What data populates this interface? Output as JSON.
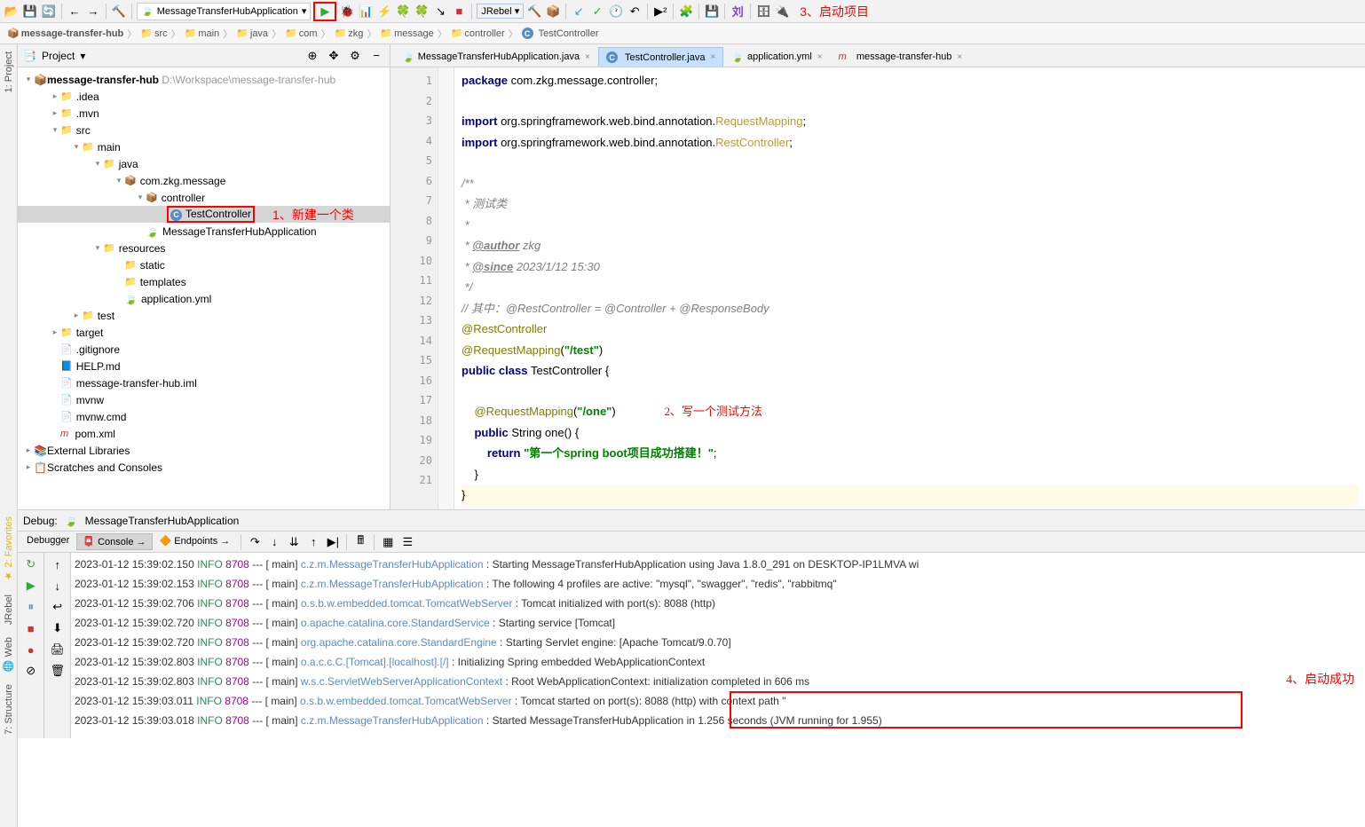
{
  "toolbar": {
    "run_config": "MessageTransferHubApplication",
    "jrebel": "JRebel"
  },
  "breadcrumb": [
    "message-transfer-hub",
    "src",
    "main",
    "java",
    "com",
    "zkg",
    "message",
    "controller",
    "TestController"
  ],
  "project": {
    "title": "Project",
    "root": "message-transfer-hub",
    "root_path": "D:\\Workspace\\message-transfer-hub",
    "tree": {
      "idea": ".idea",
      "mvn": ".mvn",
      "src": "src",
      "main": "main",
      "java": "java",
      "pkg": "com.zkg.message",
      "controller": "controller",
      "test_controller": "TestController",
      "app_class": "MessageTransferHubApplication",
      "resources": "resources",
      "static": "static",
      "templates": "templates",
      "appyml": "application.yml",
      "test": "test",
      "target": "target",
      "gitignore": ".gitignore",
      "help": "HELP.md",
      "iml": "message-transfer-hub.iml",
      "mvnw": "mvnw",
      "mvnwcmd": "mvnw.cmd",
      "pom": "pom.xml",
      "ext_lib": "External Libraries",
      "scratches": "Scratches and Consoles"
    }
  },
  "annotations": {
    "a1": "1、新建一个类",
    "a2": "2、写一个测试方法",
    "a3": "3、启动项目",
    "a4": "4、启动成功"
  },
  "tabs": [
    {
      "label": "MessageTransferHubApplication.java",
      "active": false
    },
    {
      "label": "TestController.java",
      "active": true
    },
    {
      "label": "application.yml",
      "active": false
    },
    {
      "label": "message-transfer-hub",
      "active": false
    }
  ],
  "code": {
    "l1_kw": "package",
    "l1_rest": " com.zkg.message.controller;",
    "l3_kw": "import",
    "l3_rest": " org.springframework.web.bind.annotation.",
    "l3_ref": "RequestMapping",
    "l3_end": ";",
    "l4_kw": "import",
    "l4_rest": " org.springframework.web.bind.annotation.",
    "l4_ref": "RestController",
    "l4_end": ";",
    "l6": "/**",
    "l7": " * 测试类",
    "l8": " *",
    "l9a": " * ",
    "l9b": "@author",
    "l9c": " zkg",
    "l10a": " * ",
    "l10b": "@since",
    "l10c": " 2023/1/12 15:30",
    "l11": " */",
    "l12": "// 其中：@RestController = @Controller + @ResponseBody",
    "l13": "@RestController",
    "l14a": "@RequestMapping",
    "l14b": "(",
    "l14c": "\"/test\"",
    "l14d": ")",
    "l15a": "public class ",
    "l15b": "TestController ",
    "l15c": "{",
    "l17a": "    ",
    "l17b": "@RequestMapping",
    "l17c": "(",
    "l17d": "\"/one\"",
    "l17e": ")",
    "l18a": "    ",
    "l18b": "public ",
    "l18c": "String one() {",
    "l19a": "        ",
    "l19b": "return ",
    "l19c": "\"第一个spring boot项目成功搭建！\"",
    "l19d": ";",
    "l20": "    }",
    "l21": "}"
  },
  "debug": {
    "title": "Debug:",
    "config": "MessageTransferHubApplication",
    "tab_debugger": "Debugger",
    "tab_console": "Console",
    "tab_endpoints": "Endpoints"
  },
  "console": [
    {
      "ts": "2023-01-12 15:39:02.150",
      "lv": "INFO",
      "pid": "8708",
      "th": "main",
      "src": "c.z.m.MessageTransferHubApplication",
      "msg": "Starting MessageTransferHubApplication using Java 1.8.0_291 on DESKTOP-IP1LMVA wi"
    },
    {
      "ts": "2023-01-12 15:39:02.153",
      "lv": "INFO",
      "pid": "8708",
      "th": "main",
      "src": "c.z.m.MessageTransferHubApplication",
      "msg": "The following 4 profiles are active: \"mysql\", \"swagger\", \"redis\", \"rabbitmq\""
    },
    {
      "ts": "2023-01-12 15:39:02.706",
      "lv": "INFO",
      "pid": "8708",
      "th": "main",
      "src": "o.s.b.w.embedded.tomcat.TomcatWebServer",
      "msg": "Tomcat initialized with port(s): 8088 (http)"
    },
    {
      "ts": "2023-01-12 15:39:02.720",
      "lv": "INFO",
      "pid": "8708",
      "th": "main",
      "src": "o.apache.catalina.core.StandardService",
      "msg": "Starting service [Tomcat]"
    },
    {
      "ts": "2023-01-12 15:39:02.720",
      "lv": "INFO",
      "pid": "8708",
      "th": "main",
      "src": "org.apache.catalina.core.StandardEngine",
      "msg": "Starting Servlet engine: [Apache Tomcat/9.0.70]"
    },
    {
      "ts": "2023-01-12 15:39:02.803",
      "lv": "INFO",
      "pid": "8708",
      "th": "main",
      "src": "o.a.c.c.C.[Tomcat].[localhost].[/]",
      "msg": "Initializing Spring embedded WebApplicationContext"
    },
    {
      "ts": "2023-01-12 15:39:02.803",
      "lv": "INFO",
      "pid": "8708",
      "th": "main",
      "src": "w.s.c.ServletWebServerApplicationContext",
      "msg": "Root WebApplicationContext: initialization completed in 606 ms"
    },
    {
      "ts": "2023-01-12 15:39:03.011",
      "lv": "INFO",
      "pid": "8708",
      "th": "main",
      "src": "o.s.b.w.embedded.tomcat.TomcatWebServer",
      "msg": "Tomcat started on port(s): 8088 (http) with context path ''"
    },
    {
      "ts": "2023-01-12 15:39:03.018",
      "lv": "INFO",
      "pid": "8708",
      "th": "main",
      "src": "c.z.m.MessageTransferHubApplication",
      "msg": "Started MessageTransferHubApplication in 1.256 seconds (JVM running for 1.955)"
    }
  ]
}
